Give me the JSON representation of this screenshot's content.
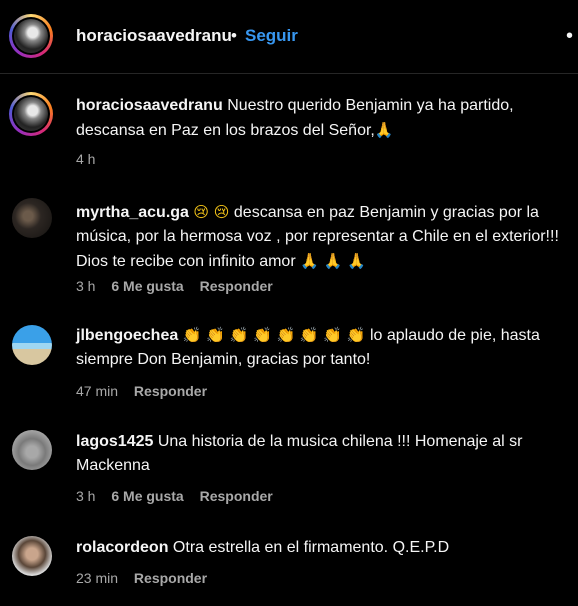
{
  "header": {
    "username": "horaciosaavedranu",
    "separator": "•",
    "follow_label": "Seguir",
    "more_icon": "more-horizontal-icon"
  },
  "comments": [
    {
      "username": "horaciosaavedranu",
      "text": "Nuestro querido Benjamin ya ha partido, descansa en Paz en los brazos del Señor,",
      "emoji_after": "🙏",
      "time": "4 h",
      "likes": "",
      "reply_label": ""
    },
    {
      "username": "myrtha_acu.ga",
      "emoji_before": "😢 😢",
      "text": "descansa en paz Benjamin y gracias por la música, por la hermosa voz , por representar a Chile en el exterior!!! Dios te recibe con infinito amor",
      "emoji_after": "🙏 🙏 🙏",
      "time": "3 h",
      "likes": "6 Me gusta",
      "reply_label": "Responder"
    },
    {
      "username": "jlbengoechea",
      "emoji_before": "👏 👏 👏 👏 👏 👏 👏 👏",
      "text": "lo aplaudo de pie, hasta siempre Don Benjamin, gracias por tanto!",
      "time": "47 min",
      "likes": "",
      "reply_label": "Responder"
    },
    {
      "username": "lagos1425",
      "text": "Una historia de la musica chilena !!! Homenaje al sr Mackenna",
      "time": "3 h",
      "likes": "6 Me gusta",
      "reply_label": "Responder"
    },
    {
      "username": "rolacordeon",
      "text": "Otra estrella en el firmamento. Q.E.P.D",
      "time": "23 min",
      "likes": "",
      "reply_label": "Responder"
    }
  ]
}
